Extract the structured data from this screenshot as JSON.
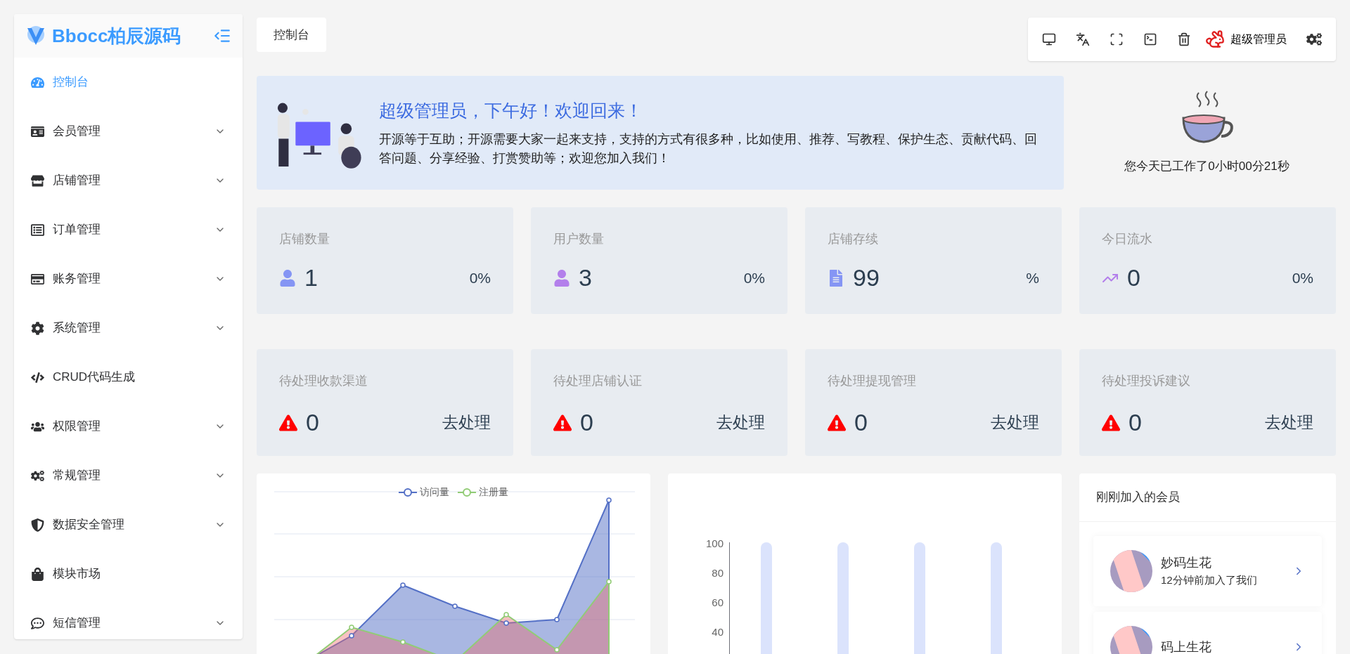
{
  "sidebar": {
    "logo": "Bbocc柏辰源码",
    "items": [
      {
        "label": "控制台",
        "selected": true,
        "expandable": false
      },
      {
        "label": "会员管理",
        "selected": false,
        "expandable": true
      },
      {
        "label": "店铺管理",
        "selected": false,
        "expandable": true
      },
      {
        "label": "订单管理",
        "selected": false,
        "expandable": true
      },
      {
        "label": "账务管理",
        "selected": false,
        "expandable": true
      },
      {
        "label": "系统管理",
        "selected": false,
        "expandable": true
      },
      {
        "label": "CRUD代码生成",
        "selected": false,
        "expandable": false
      },
      {
        "label": "权限管理",
        "selected": false,
        "expandable": true
      },
      {
        "label": "常规管理",
        "selected": false,
        "expandable": true
      },
      {
        "label": "数据安全管理",
        "selected": false,
        "expandable": true
      },
      {
        "label": "模块市场",
        "selected": false,
        "expandable": false
      },
      {
        "label": "短信管理",
        "selected": false,
        "expandable": true
      }
    ]
  },
  "tabs": [
    {
      "label": "控制台",
      "selected": true
    }
  ],
  "toolbar": {
    "user": "超级管理员"
  },
  "banner": {
    "title": "超级管理员，下午好！欢迎回来！",
    "text": "开源等于互助；开源需要大家一起来支持，支持的方式有很多种，比如使用、推荐、写教程、保护生态、贡献代码、回答问题、分享经验、打赏赞助等；欢迎您加入我们！"
  },
  "work_time": "您今天已工作了0小时00分21秒",
  "stats": [
    {
      "label": "店铺数量",
      "value": "1",
      "percent": "0%",
      "color": "#8595f4"
    },
    {
      "label": "用户数量",
      "value": "3",
      "percent": "0%",
      "color": "#b37feb"
    },
    {
      "label": "店铺存续",
      "value": "99",
      "percent": "%",
      "color": "#8595f4"
    },
    {
      "label": "今日流水",
      "value": "0",
      "percent": "0%",
      "color": "#b37feb"
    }
  ],
  "pending": [
    {
      "label": "待处理收款渠道",
      "value": "0",
      "action": "去处理"
    },
    {
      "label": "待处理店铺认证",
      "value": "0",
      "action": "去处理"
    },
    {
      "label": "待处理提现管理",
      "value": "0",
      "action": "去处理"
    },
    {
      "label": "待处理投诉建议",
      "value": "0",
      "action": "去处理"
    }
  ],
  "line_chart": {
    "legend": [
      {
        "name": "访问量",
        "color": "#5470c6"
      },
      {
        "name": "注册量",
        "color": "#91cc75"
      }
    ]
  },
  "bar_chart": {
    "y_ticks": [
      "100",
      "80",
      "60",
      "40"
    ]
  },
  "members": {
    "title": "刚刚加入的会员",
    "items": [
      {
        "name": "妙码生花",
        "time": "12分钟前加入了我们"
      },
      {
        "name": "码上生花"
      }
    ]
  }
}
